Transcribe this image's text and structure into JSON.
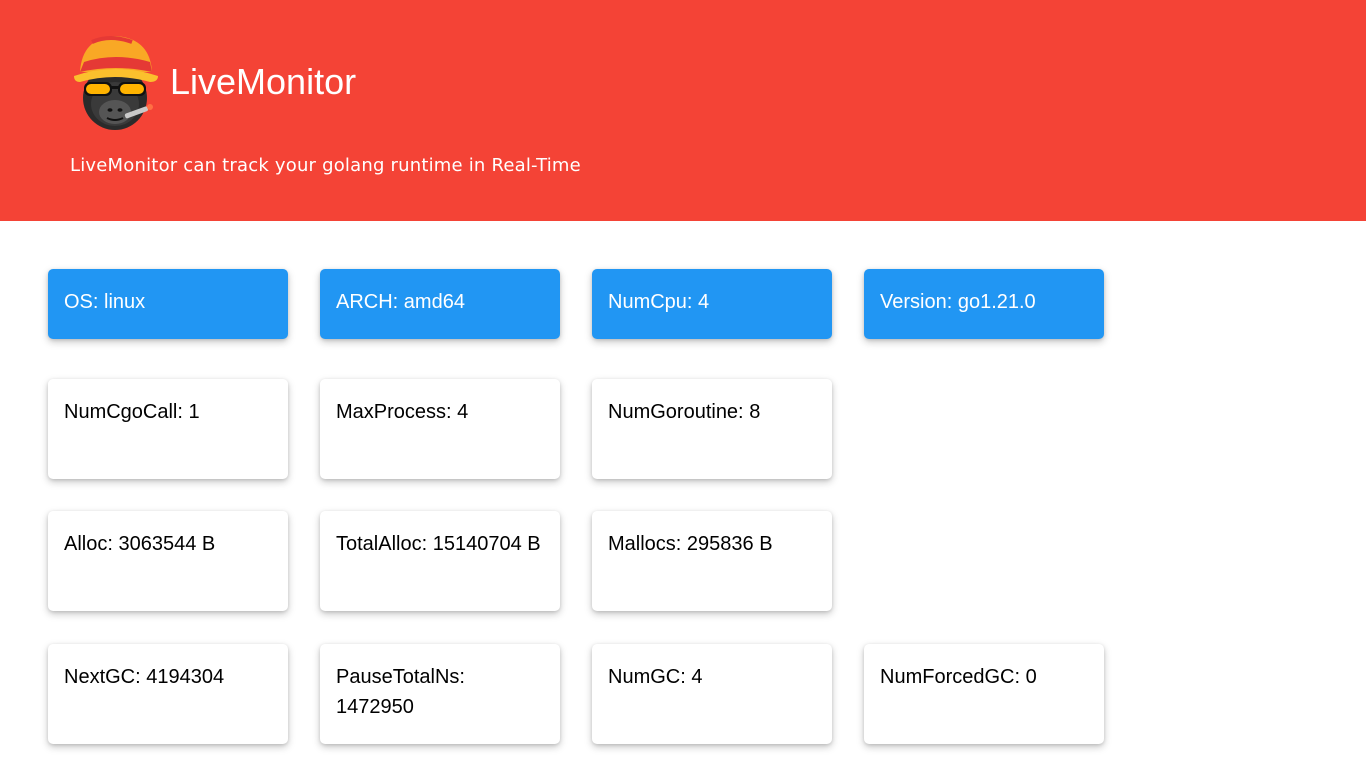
{
  "app": {
    "title": "LiveMonitor",
    "subtitle": "LiveMonitor can track your golang runtime in Real-Time",
    "logo_icon": "gorilla-bucket-hat-logo",
    "header_color": "#f44336",
    "info_card_color": "#2196f3"
  },
  "system_info": [
    {
      "label": "OS:",
      "value": "linux"
    },
    {
      "label": "ARCH:",
      "value": "amd64"
    },
    {
      "label": "NumCpu:",
      "value": "4"
    },
    {
      "label": "Version:",
      "value": "go1.21.0"
    }
  ],
  "runtime_stats": [
    {
      "label": "NumCgoCall:",
      "value": "1"
    },
    {
      "label": "MaxProcess:",
      "value": "4"
    },
    {
      "label": "NumGoroutine:",
      "value": "8"
    }
  ],
  "memory_stats": [
    {
      "label": "Alloc:",
      "value": "3063544 B"
    },
    {
      "label": "TotalAlloc:",
      "value": "15140704 B"
    },
    {
      "label": "Mallocs:",
      "value": "295836 B"
    }
  ],
  "gc_stats": [
    {
      "label": "NextGC:",
      "value": "4194304"
    },
    {
      "label": "PauseTotalNs:",
      "value": "1472950"
    },
    {
      "label": "NumGC:",
      "value": "4"
    },
    {
      "label": "NumForcedGC:",
      "value": "0"
    }
  ]
}
